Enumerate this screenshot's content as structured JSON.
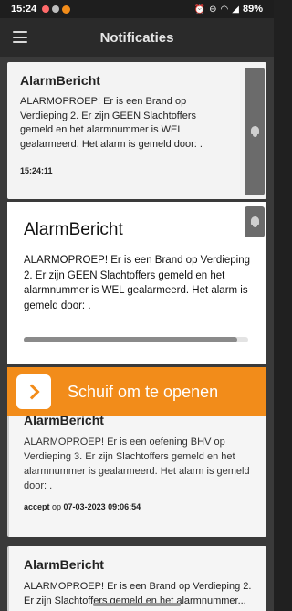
{
  "status_bar": {
    "time": "15:24",
    "battery": "89%",
    "icons": [
      "notification-icon",
      "app-icon",
      "app-icon",
      "alarm-icon",
      "dnd-icon",
      "wifi-icon",
      "signal-icon"
    ]
  },
  "appbar": {
    "title": "Notificaties",
    "menu_icon": "menu-icon"
  },
  "cards": [
    {
      "title": "AlarmBericht",
      "body": "ALARMOPROEP! Er is een Brand op Verdieping 2. Er zijn GEEN Slachtoffers gemeld en het alarmnummer is WEL gealarmeerd. Het alarm is gemeld door: .",
      "footer": "15:24:11"
    },
    {
      "title": "AlarmBericht",
      "body": "ALARMOPROEP! Er is een oefening BHV op Verdieping 3. Er zijn Slachtoffers gemeld en het alarmnummer is gealarmeerd. Het alarm is gemeld door: .",
      "footer_action": "accept",
      "footer_op": " op ",
      "footer_time": "07-03-2023 09:06:54"
    },
    {
      "title": "AlarmBericht",
      "body": "ALARMOPROEP! Er is een Brand op Verdieping 2. Er zijn Slachtoffers gemeld en het alarmnummer..."
    }
  ],
  "modal": {
    "title": "AlarmBericht",
    "body": "ALARMOPROEP! Er is een Brand op Verdieping 2. Er zijn GEEN Slachtoffers gemeld en het alarmnummer is WEL gealarmeerd. Het alarm is gemeld door: .",
    "progress": 0.95
  },
  "slider": {
    "label": "Schuif om te openen",
    "color": "#f28c1a"
  }
}
